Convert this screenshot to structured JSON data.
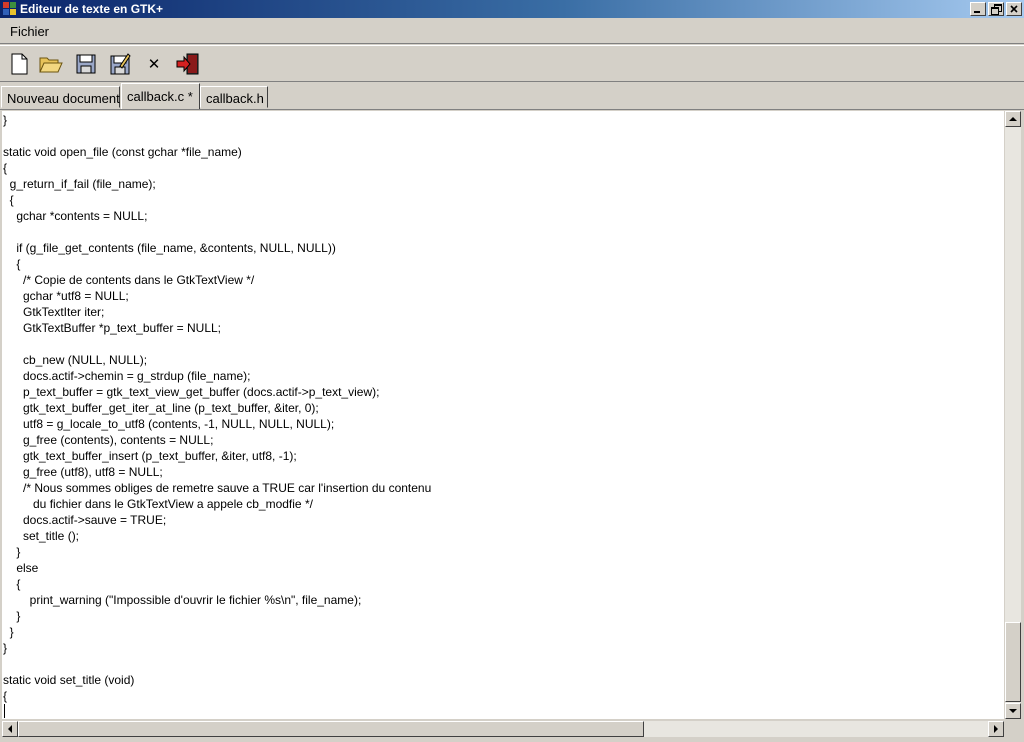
{
  "window": {
    "title": "Editeur de texte en GTK+"
  },
  "menubar": {
    "items": [
      "Fichier"
    ]
  },
  "toolbar": {
    "buttons": [
      "new-file",
      "open-file",
      "save",
      "save-as",
      "close",
      "quit"
    ],
    "close_glyph": "✕"
  },
  "tabs": [
    {
      "label": "Nouveau document",
      "active": false
    },
    {
      "label": "callback.c *",
      "active": true
    },
    {
      "label": "callback.h",
      "active": false
    }
  ],
  "editor": {
    "lines": [
      "}",
      "",
      "static void open_file (const gchar *file_name)",
      "{",
      "  g_return_if_fail (file_name);",
      "  {",
      "    gchar *contents = NULL;",
      "",
      "    if (g_file_get_contents (file_name, &contents, NULL, NULL))",
      "    {",
      "      /* Copie de contents dans le GtkTextView */",
      "      gchar *utf8 = NULL;",
      "      GtkTextIter iter;",
      "      GtkTextBuffer *p_text_buffer = NULL;",
      "",
      "      cb_new (NULL, NULL);",
      "      docs.actif->chemin = g_strdup (file_name);",
      "      p_text_buffer = gtk_text_view_get_buffer (docs.actif->p_text_view);",
      "      gtk_text_buffer_get_iter_at_line (p_text_buffer, &iter, 0);",
      "      utf8 = g_locale_to_utf8 (contents, -1, NULL, NULL, NULL);",
      "      g_free (contents), contents = NULL;",
      "      gtk_text_buffer_insert (p_text_buffer, &iter, utf8, -1);",
      "      g_free (utf8), utf8 = NULL;",
      "      /* Nous sommes obliges de remetre sauve a TRUE car l'insertion du contenu",
      "         du fichier dans le GtkTextView a appele cb_modfie */",
      "      docs.actif->sauve = TRUE;",
      "      set_title ();",
      "    }",
      "    else",
      "    {",
      "        print_warning (\"Impossible d'ouvrir le fichier %s\\n\", file_name);",
      "    }",
      "  }",
      "}",
      "",
      "static void set_title (void)",
      "{",
      ""
    ]
  },
  "scroll": {
    "vertical_position": 0.98,
    "horizontal_position": 0.0
  }
}
